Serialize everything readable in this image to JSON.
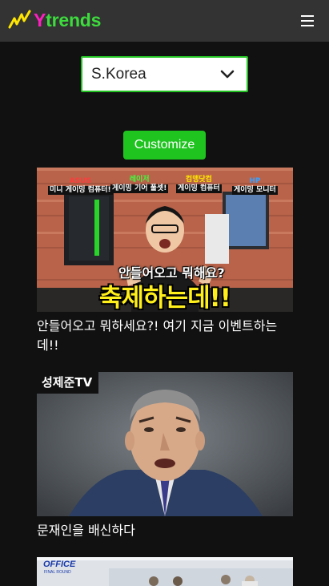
{
  "app": {
    "logo_y": "Y",
    "logo_rest": "trends",
    "logo_colors": {
      "y": "#ff1fbf",
      "rest": "#3ddc3d",
      "zigzag": "#ffe600"
    },
    "menu_icon": "hamburger-menu-icon"
  },
  "country_select": {
    "value": "S.Korea",
    "icon": "chevron-down-icon",
    "border_color": "#22c322"
  },
  "customize_button": {
    "label": "Customize",
    "color": "#1fc41f"
  },
  "videos": [
    {
      "title": "안들어오고 뭐하세요?! 여기 지금 이벤트하는데!!",
      "thumbnail": {
        "labels": [
          {
            "brand": "ASUS",
            "text": "미니 게이밍 컴퓨터!"
          },
          {
            "brand": "레이저",
            "text": "게이밍 기어 풀셋!"
          },
          {
            "brand": "컴맹닷컴",
            "text": "게이밍 컴퓨터"
          },
          {
            "brand": "HP",
            "text": "게이밍 모니터"
          }
        ],
        "subtitle": "안들어오고 뭐해요?",
        "headline": "축제하는데!!"
      }
    },
    {
      "title": "문재인을 배신하다",
      "thumbnail": {
        "channel": "성제준TV"
      }
    },
    {
      "title": "",
      "thumbnail": {
        "logo": "OFFICE",
        "logo_sub": "FINAL ROUND"
      }
    }
  ]
}
